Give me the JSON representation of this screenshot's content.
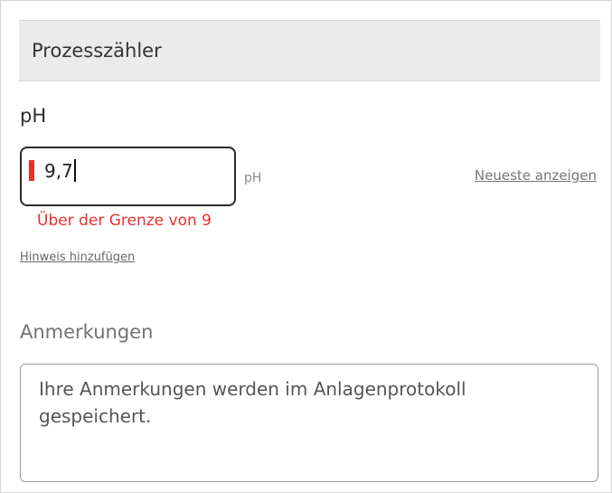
{
  "section": {
    "title": "Prozesszähler"
  },
  "field": {
    "label": "pH",
    "value": "9,7",
    "unit": "pH",
    "latest_link": "Neueste anzeigen",
    "error_message": "Über der Grenze von 9",
    "add_note_link": "Hinweis hinzufügen"
  },
  "remarks": {
    "label": "Anmerkungen",
    "placeholder": "Ihre Anmerkungen werden im Anlagenprotokoll gespeichert."
  },
  "colors": {
    "error": "#e8302a",
    "header_bg": "#ebebeb"
  }
}
